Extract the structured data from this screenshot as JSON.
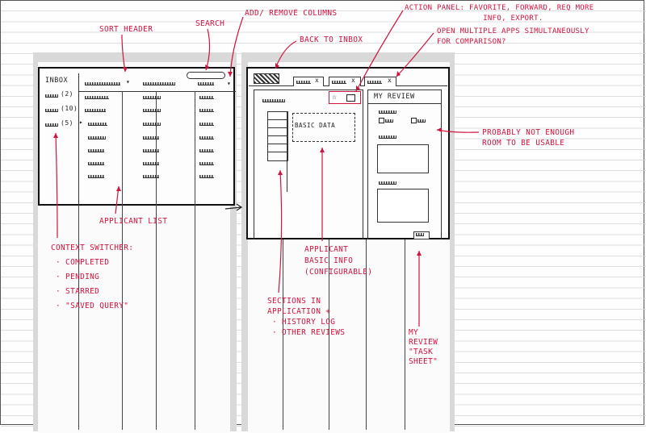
{
  "annotations": {
    "sort_header": "SORT HEADER",
    "search": "SEARCH",
    "add_remove_columns": "ADD/ REMOVE COLUMNS",
    "back_to_inbox": "BACK TO INBOX",
    "action_panel": "ACTION PANEL: FAVORITE, FORWARD, REQ MORE\n                 INFO, EXPORT.",
    "open_multiple": "OPEN MULTIPLE APPS SIMULTANEOUSLY\nFOR COMPARISON?",
    "not_enough_room": "PROBABLY NOT ENOUGH\nROOM TO BE USABLE",
    "applicant_list": "APPLICANT LIST",
    "context_switcher": "CONTEXT SWITCHER:\n · COMPLETED\n · PENDING\n · STARRED\n · \"SAVED QUERY\"",
    "applicant_basic_info": "APPLICANT\nBASIC INFO\n(CONFIGURABLE)",
    "sections_in_application": "SECTIONS IN\nAPPLICATION +\n · HISTORY LOG\n · OTHER REVIEWS",
    "my_review_task_sheet": "MY\nREVIEW\n\"TASK\nSHEET\""
  },
  "inbox_screen": {
    "title": "INBOX",
    "folders": [
      "(2)",
      "(10)",
      "(5)"
    ]
  },
  "detail_screen": {
    "basic_data_label": "BASIC DATA",
    "my_review_title": "MY REVIEW",
    "tab_close_glyph": "x",
    "star_glyph": "☆"
  },
  "colors": {
    "annotation": "#d1143e",
    "sketch": "#222222",
    "frame_gray": "#d9d9d9"
  }
}
